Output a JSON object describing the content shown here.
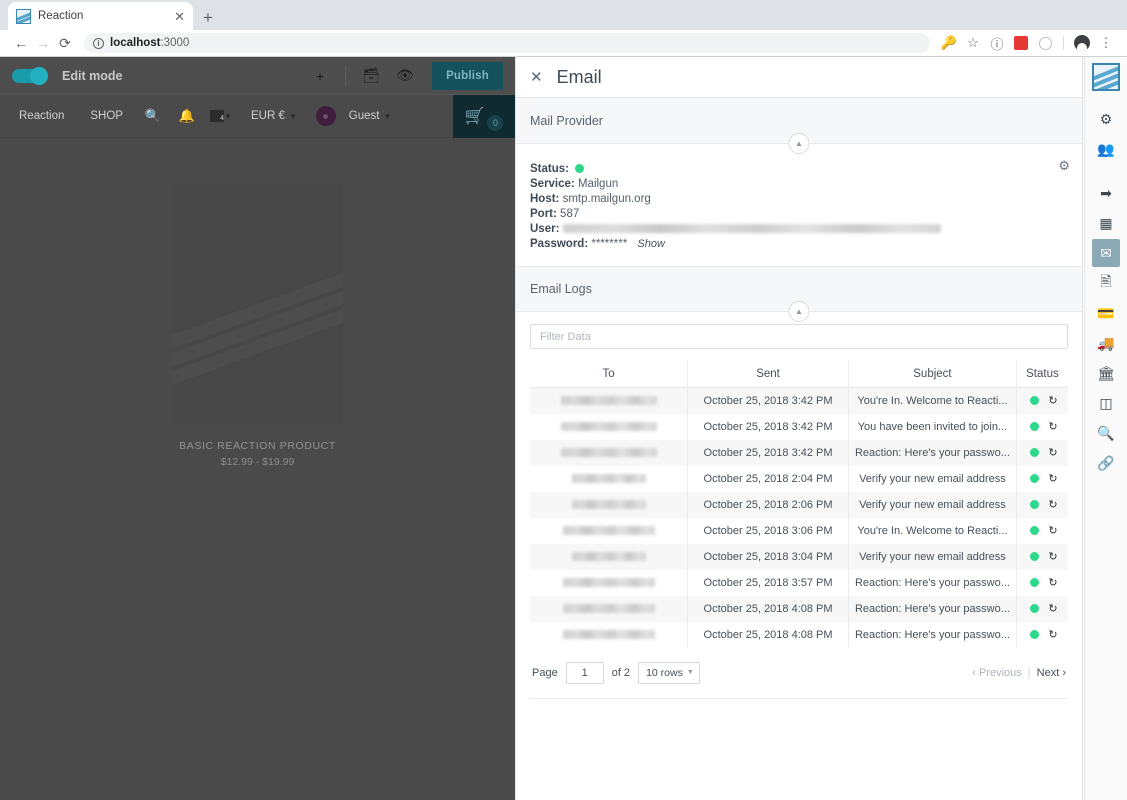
{
  "browser": {
    "tab_title": "Reaction",
    "tab_close_icon": "close-icon",
    "new_tab_icon": "plus-icon",
    "back_icon": "arrow-left-icon",
    "forward_icon": "arrow-right-icon",
    "reload_icon": "reload-icon",
    "info_icon": "info-circle-icon",
    "url_host": "localhost",
    "url_port": ":3000",
    "toolbar_icons": [
      "key-icon",
      "star-icon",
      "info-icon",
      "extension-red-icon",
      "extension-gray-icon",
      "profile-avatar",
      "kebab-menu-icon"
    ]
  },
  "storefront": {
    "editbar": {
      "toggle_state": "on",
      "label": "Edit mode",
      "add_label": "+",
      "archive_icon": "archive-icon",
      "preview_icon": "eye-icon",
      "publish_label": "Publish"
    },
    "nav": {
      "brand": "Reaction",
      "shop": "SHOP",
      "search_icon": "search-icon",
      "bell_icon": "bell-icon",
      "language_label": "",
      "currency_label": "EUR €",
      "account_label": "Guest",
      "cart_icon": "cart-icon",
      "cart_count": "0"
    },
    "product": {
      "name": "BASIC REACTION PRODUCT",
      "price": "$12.99 - $19.99"
    }
  },
  "panel": {
    "close_icon": "close-icon",
    "title": "Email",
    "provider": {
      "section_title": "Mail Provider",
      "collapse_icon": "chevron-up-icon",
      "settings_icon": "gear-icon",
      "status_label": "Status:",
      "status_value": "online",
      "status_color": "#2cd889",
      "service_label": "Service:",
      "service_value": "Mailgun",
      "host_label": "Host:",
      "host_value": "smtp.mailgun.org",
      "port_label": "Port:",
      "port_value": "587",
      "user_label": "User:",
      "user_value": "",
      "password_label": "Password:",
      "password_value": "********",
      "password_show_label": "Show"
    },
    "logs": {
      "section_title": "Email Logs",
      "collapse_icon": "chevron-up-icon",
      "filter_placeholder": "Filter Data",
      "columns": [
        "To",
        "Sent",
        "Subject",
        "Status"
      ],
      "rows": [
        {
          "to": "",
          "to_width": 96,
          "sent": "October 25, 2018 3:42 PM",
          "subject": "You're In. Welcome to Reacti...",
          "status": "sent",
          "resend_icon": "resend-icon"
        },
        {
          "to": "",
          "to_width": 96,
          "sent": "October 25, 2018 3:42 PM",
          "subject": "You have been invited to join...",
          "status": "sent",
          "resend_icon": "resend-icon"
        },
        {
          "to": "",
          "to_width": 96,
          "sent": "October 25, 2018 3:42 PM",
          "subject": "Reaction: Here's your passwo...",
          "status": "sent",
          "resend_icon": "resend-icon"
        },
        {
          "to": "",
          "to_width": 74,
          "sent": "October 25, 2018 2:04 PM",
          "subject": "Verify your new email address",
          "status": "sent",
          "resend_icon": "resend-icon"
        },
        {
          "to": "",
          "to_width": 74,
          "sent": "October 25, 2018 2:06 PM",
          "subject": "Verify your new email address",
          "status": "sent",
          "resend_icon": "resend-icon"
        },
        {
          "to": "",
          "to_width": 92,
          "sent": "October 25, 2018 3:06 PM",
          "subject": "You're In. Welcome to Reacti...",
          "status": "sent",
          "resend_icon": "resend-icon"
        },
        {
          "to": "",
          "to_width": 74,
          "sent": "October 25, 2018 3:04 PM",
          "subject": "Verify your new email address",
          "status": "sent",
          "resend_icon": "resend-icon"
        },
        {
          "to": "",
          "to_width": 92,
          "sent": "October 25, 2018 3:57 PM",
          "subject": "Reaction: Here's your passwo...",
          "status": "sent",
          "resend_icon": "resend-icon"
        },
        {
          "to": "",
          "to_width": 92,
          "sent": "October 25, 2018 4:08 PM",
          "subject": "Reaction: Here's your passwo...",
          "status": "sent",
          "resend_icon": "resend-icon"
        },
        {
          "to": "",
          "to_width": 92,
          "sent": "October 25, 2018 4:08 PM",
          "subject": "Reaction: Here's your passwo...",
          "status": "sent",
          "resend_icon": "resend-icon"
        }
      ],
      "pager": {
        "page_label": "Page",
        "page_value": "1",
        "of_label": "of 2",
        "rows_per_page": "10 rows",
        "previous_label": "‹ Previous",
        "divider": "|",
        "next_label": "Next ›"
      }
    }
  },
  "sidebar": {
    "logo": "reaction-logo",
    "items": [
      {
        "name": "sidebar-item-settings",
        "icon": "gear-icon"
      },
      {
        "name": "sidebar-item-accounts",
        "icon": "people-icon"
      },
      {
        "name": "sidebar-item-login",
        "icon": "sign-in-icon"
      },
      {
        "name": "sidebar-item-apps",
        "icon": "grid-icon"
      },
      {
        "name": "sidebar-item-email",
        "icon": "mail-icon",
        "active": true
      },
      {
        "name": "sidebar-item-orders",
        "icon": "file-icon"
      },
      {
        "name": "sidebar-item-payments",
        "icon": "credit-card-icon"
      },
      {
        "name": "sidebar-item-shipping",
        "icon": "truck-icon"
      },
      {
        "name": "sidebar-item-taxes",
        "icon": "bank-icon"
      },
      {
        "name": "sidebar-item-layout",
        "icon": "columns-icon"
      },
      {
        "name": "sidebar-item-search",
        "icon": "search-icon"
      },
      {
        "name": "sidebar-item-social",
        "icon": "share-icon"
      }
    ]
  },
  "colors": {
    "accent_teal": "#15525e",
    "status_green": "#2cd889",
    "sidebar_active": "#8ba9b5",
    "storefront_bg": "#4a4a4a"
  }
}
